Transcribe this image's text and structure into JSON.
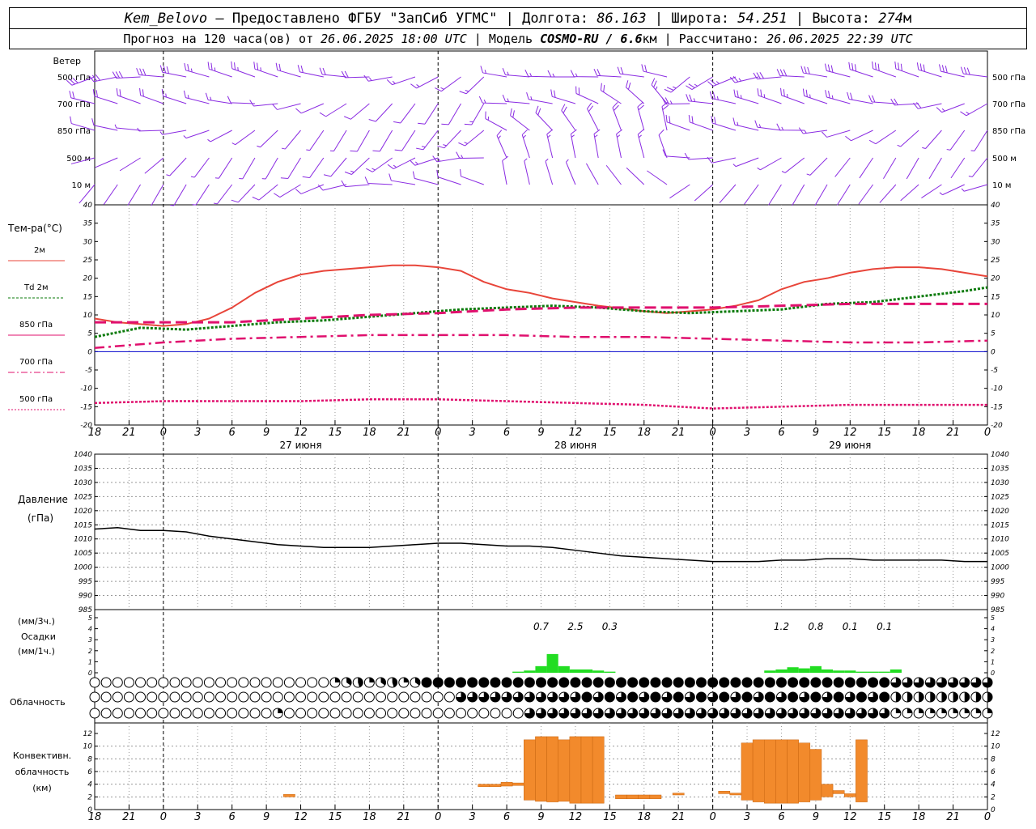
{
  "header": {
    "station": "Kem_Belovo",
    "provider": " – Предоставлено ФГБУ \"ЗапСиб УГМС\" | ",
    "lon_label": "Долгота: ",
    "lon": "86.163",
    "lat_label": " | Широта: ",
    "lat": "54.251",
    "alt_label": " | Высота: ",
    "alt": "274",
    "alt_unit": "м",
    "forecast_prefix": "Прогноз на 120 часа(ов) от ",
    "forecast_start": "26.06.2025 18:00 UTC",
    "model_label": "  | Модель ",
    "model": "COSMO-RU / 6.6",
    "model_unit": "км",
    "computed_label": " | Рассчитано: ",
    "computed": "26.06.2025 22:39 UTC"
  },
  "colors": {
    "wind": "#8a2be2",
    "t2m": "#e8453a",
    "td2m": "#0a7a0a",
    "t850": "#e0106e",
    "t700": "#e0106e",
    "t500": "#e0106e",
    "pressure": "#000000",
    "precip": "#22dd22",
    "convective": "#f28a2c",
    "zero_line": "#0000cc"
  },
  "time_axis": {
    "tick_labels": [
      "18",
      "21",
      "0",
      "3",
      "6",
      "9",
      "12",
      "15",
      "18",
      "21",
      "0",
      "3",
      "6",
      "9",
      "12",
      "15",
      "18",
      "21",
      "0",
      "3",
      "6",
      "9",
      "12",
      "15",
      "18",
      "21",
      "0"
    ],
    "day_labels": [
      "27 июня",
      "28 июня",
      "29 июня"
    ]
  },
  "wind_panel": {
    "title": "Ветер",
    "levels": [
      "500 гПа",
      "700 гПа",
      "850 гПа",
      "500 м",
      "10  м"
    ]
  },
  "temp_panel": {
    "title": "Тем-ра(°C)",
    "legend": [
      "2м",
      "Td  2м",
      "850 гПа",
      "700 гПа",
      "500 гПа"
    ],
    "ticks": [
      "40",
      "35",
      "30",
      "25",
      "20",
      "15",
      "10",
      "5",
      "0",
      "-5",
      "-10",
      "-15",
      "-20"
    ]
  },
  "pressure_panel": {
    "title": "Давление",
    "unit": "(гПа)",
    "ticks": [
      "1040",
      "1035",
      "1030",
      "1025",
      "1020",
      "1015",
      "1010",
      "1005",
      "1000",
      "995",
      "990",
      "985"
    ]
  },
  "precip_panel": {
    "unit_3h": "(мм/3ч.)",
    "title": "Осадки",
    "unit_1h": "(мм/1ч.)",
    "ticks": [
      "5",
      "4",
      "3",
      "2",
      "1",
      "0"
    ],
    "totals": [
      {
        "hour": 39,
        "label": "0.7"
      },
      {
        "hour": 42,
        "label": "2.5"
      },
      {
        "hour": 45,
        "label": "0.3"
      },
      {
        "hour": 60,
        "label": "1.2"
      },
      {
        "hour": 63,
        "label": "0.8"
      },
      {
        "hour": 66,
        "label": "0.1"
      },
      {
        "hour": 69,
        "label": "0.1"
      }
    ]
  },
  "cloud_panel": {
    "title": "Облачность"
  },
  "conv_panel": {
    "title": [
      "Конвективн.",
      "облачность",
      "(км)"
    ],
    "ticks": [
      "12",
      "10",
      "8",
      "6",
      "4",
      "2",
      "0"
    ]
  },
  "chart_data": {
    "type": "line",
    "x_unit": "hours since 26.06.2025 18:00 UTC",
    "temperature": {
      "ylim": [
        -20,
        40
      ],
      "series": [
        {
          "name": "2м",
          "x": [
            0,
            2,
            4,
            6,
            8,
            10,
            12,
            14,
            16,
            18,
            20,
            22,
            24,
            26,
            28,
            30,
            32,
            34,
            36,
            38,
            40,
            42,
            44,
            46,
            48,
            50,
            52,
            54,
            56,
            58,
            60,
            62,
            64,
            66,
            68,
            70,
            72,
            74,
            76,
            78
          ],
          "values": [
            9,
            8,
            7.5,
            7,
            7.5,
            9,
            12,
            16,
            19,
            21,
            22,
            22.5,
            23,
            23.5,
            23.5,
            23,
            22,
            19,
            17,
            16,
            14.5,
            13.5,
            12.5,
            11.8,
            11,
            10.5,
            11,
            11.5,
            12.5,
            14,
            17,
            19,
            20,
            21.5,
            22.5,
            23,
            23,
            22.5,
            21.5,
            20.5
          ]
        },
        {
          "name": "Td  2м",
          "x": [
            0,
            4,
            8,
            12,
            16,
            20,
            24,
            28,
            32,
            36,
            40,
            44,
            48,
            52,
            56,
            60,
            64,
            68,
            72,
            76,
            78
          ],
          "values": [
            4,
            6.5,
            6,
            7,
            8,
            8.5,
            9.5,
            10.5,
            11.5,
            12,
            12.5,
            12,
            11,
            10.5,
            11,
            11.5,
            13,
            13.5,
            15,
            16.5,
            17.5
          ]
        },
        {
          "name": "850 гПа",
          "x": [
            0,
            6,
            12,
            18,
            24,
            30,
            36,
            42,
            48,
            54,
            60,
            66,
            72,
            78
          ],
          "values": [
            8,
            8,
            8,
            9,
            10,
            10.5,
            11.5,
            12,
            12,
            12,
            12.5,
            13,
            13,
            13
          ]
        },
        {
          "name": "700 гПа",
          "x": [
            0,
            6,
            12,
            18,
            24,
            30,
            36,
            42,
            48,
            54,
            60,
            66,
            72,
            78
          ],
          "values": [
            1,
            2.5,
            3.5,
            4,
            4.5,
            4.5,
            4.5,
            4,
            4,
            3.5,
            3,
            2.5,
            2.5,
            3
          ]
        },
        {
          "name": "500 гПа",
          "x": [
            0,
            6,
            12,
            18,
            24,
            30,
            36,
            42,
            48,
            54,
            60,
            66,
            72,
            78
          ],
          "values": [
            -14,
            -13.5,
            -13.5,
            -13.5,
            -13,
            -13,
            -13.5,
            -14,
            -14.5,
            -15.5,
            -15,
            -14.5,
            -14.5,
            -14.5
          ]
        }
      ]
    },
    "pressure": {
      "ylim": [
        985,
        1040
      ],
      "x": [
        0,
        2,
        4,
        6,
        8,
        10,
        12,
        14,
        16,
        18,
        20,
        22,
        24,
        26,
        28,
        30,
        32,
        34,
        36,
        38,
        40,
        42,
        44,
        46,
        48,
        50,
        52,
        54,
        56,
        58,
        60,
        62,
        64,
        66,
        68,
        70,
        72,
        74,
        76,
        78
      ],
      "values": [
        1013.5,
        1014,
        1013,
        1013,
        1012.5,
        1011,
        1010,
        1009,
        1008,
        1007.5,
        1007,
        1007,
        1007,
        1007.5,
        1008,
        1008.5,
        1008.5,
        1008,
        1007.5,
        1007.5,
        1007,
        1006,
        1005,
        1004,
        1003.5,
        1003,
        1002.5,
        1002,
        1002,
        1002,
        1002.5,
        1002.5,
        1003,
        1003,
        1002.5,
        1002.5,
        1002.5,
        1002.5,
        1002,
        1002
      ]
    },
    "precipitation": {
      "ylim": [
        0,
        5
      ],
      "x": [
        37,
        38,
        39,
        40,
        41,
        42,
        43,
        44,
        45,
        59,
        60,
        61,
        62,
        63,
        64,
        65,
        66,
        67,
        68,
        69,
        70
      ],
      "values": [
        0.1,
        0.2,
        0.6,
        1.7,
        0.6,
        0.3,
        0.3,
        0.2,
        0.1,
        0.2,
        0.3,
        0.5,
        0.4,
        0.6,
        0.3,
        0.2,
        0.2,
        0.1,
        0.1,
        0.1,
        0.3
      ]
    },
    "convective_cloud": {
      "ylim": [
        0,
        13
      ],
      "bars": [
        {
          "x": 17,
          "base": 2.0,
          "top": 2.4
        },
        {
          "x": 34,
          "base": 3.6,
          "top": 4.0
        },
        {
          "x": 35,
          "base": 3.6,
          "top": 4.0
        },
        {
          "x": 36,
          "base": 3.7,
          "top": 4.3
        },
        {
          "x": 37,
          "base": 3.8,
          "top": 4.2
        },
        {
          "x": 38,
          "base": 1.5,
          "top": 11.0
        },
        {
          "x": 39,
          "base": 1.3,
          "top": 11.5
        },
        {
          "x": 40,
          "base": 1.2,
          "top": 11.5
        },
        {
          "x": 41,
          "base": 1.3,
          "top": 11.0
        },
        {
          "x": 42,
          "base": 1.0,
          "top": 11.5
        },
        {
          "x": 43,
          "base": 1.0,
          "top": 11.5
        },
        {
          "x": 44,
          "base": 1.0,
          "top": 11.5
        },
        {
          "x": 46,
          "base": 1.7,
          "top": 2.3
        },
        {
          "x": 47,
          "base": 1.7,
          "top": 2.3
        },
        {
          "x": 48,
          "base": 1.7,
          "top": 2.3
        },
        {
          "x": 49,
          "base": 1.7,
          "top": 2.3
        },
        {
          "x": 51,
          "base": 2.3,
          "top": 2.6
        },
        {
          "x": 55,
          "base": 2.5,
          "top": 2.9
        },
        {
          "x": 56,
          "base": 2.3,
          "top": 2.6
        },
        {
          "x": 57,
          "base": 1.5,
          "top": 10.5
        },
        {
          "x": 58,
          "base": 1.2,
          "top": 11.0
        },
        {
          "x": 59,
          "base": 1.0,
          "top": 11.0
        },
        {
          "x": 60,
          "base": 1.0,
          "top": 11.0
        },
        {
          "x": 61,
          "base": 1.0,
          "top": 11.0
        },
        {
          "x": 62,
          "base": 1.2,
          "top": 10.5
        },
        {
          "x": 63,
          "base": 1.5,
          "top": 9.5
        },
        {
          "x": 64,
          "base": 2.0,
          "top": 4.0
        },
        {
          "x": 65,
          "base": 2.5,
          "top": 3.0
        },
        {
          "x": 66,
          "base": 2.0,
          "top": 2.5
        },
        {
          "x": 67,
          "base": 1.2,
          "top": 11.0
        }
      ]
    }
  }
}
